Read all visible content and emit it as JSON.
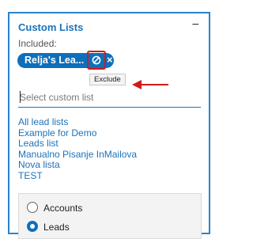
{
  "panel": {
    "title": "Custom Lists",
    "collapse_label": "−",
    "included_label": "Included:"
  },
  "chip": {
    "label": "Relja's Lea...",
    "remove_label": "×",
    "exclude_tooltip": "Exclude"
  },
  "search": {
    "placeholder": "Select custom list"
  },
  "lists": [
    "All lead lists",
    "Example for Demo",
    "Leads list",
    "Manualno Pisanje InMailova",
    "Nova lista",
    "TEST"
  ],
  "radio": {
    "options": [
      "Accounts",
      "Leads"
    ],
    "selected": "Leads"
  },
  "colors": {
    "accent": "#1d72b8",
    "chip": "#0e6fbb",
    "highlight": "#d21a1a"
  }
}
